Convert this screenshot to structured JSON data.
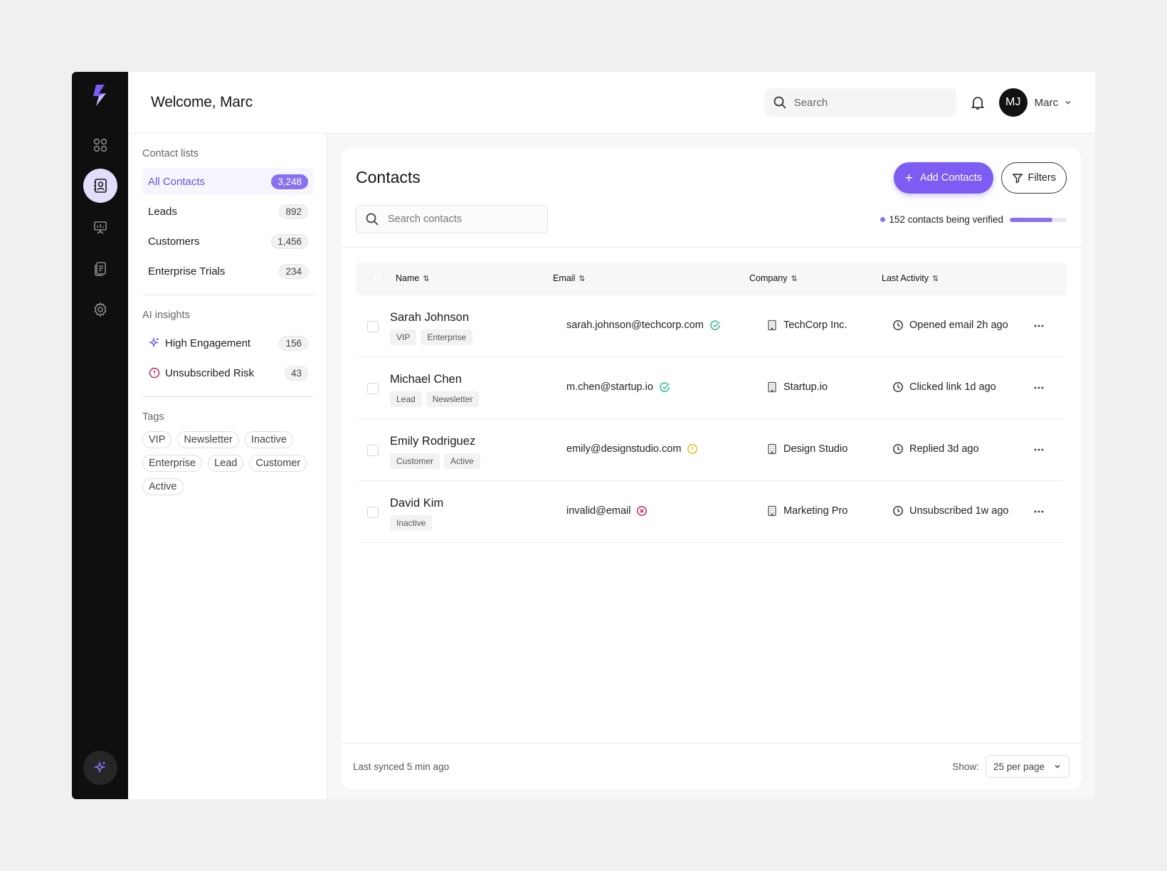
{
  "header": {
    "welcome": "Welcome, Marc",
    "search_placeholder": "Search",
    "avatar_initials": "MJ",
    "user_name": "Marc"
  },
  "lists": {
    "contact_lists_title": "Contact lists",
    "items": [
      {
        "label": "All Contacts",
        "count": "3,248",
        "active": true
      },
      {
        "label": "Leads",
        "count": "892"
      },
      {
        "label": "Customers",
        "count": "1,456"
      },
      {
        "label": "Enterprise Trials",
        "count": "234"
      }
    ],
    "ai_title": "AI insights",
    "ai_items": [
      {
        "label": "High Engagement",
        "count": "156",
        "icon": "sparkle-icon"
      },
      {
        "label": "Unsubscribed Risk",
        "count": "43",
        "icon": "alert-circle-icon"
      }
    ],
    "tags_title": "Tags",
    "tags": [
      "VIP",
      "Newsletter",
      "Inactive",
      "Enterprise",
      "Lead",
      "Customer",
      "Active"
    ]
  },
  "contacts": {
    "title": "Contacts",
    "add_label": "Add Contacts",
    "filters_label": "Filters",
    "search_placeholder": "Search contacts",
    "verifying_text": "152 contacts being verified",
    "verify_progress": 0.75,
    "columns": {
      "name": "Name",
      "email": "Email",
      "company": "Company",
      "activity": "Last Activity"
    },
    "rows": [
      {
        "name": "Sarah Johnson",
        "tags": [
          "VIP",
          "Enterprise"
        ],
        "email": "sarah.johnson@techcorp.com",
        "email_status": "verified",
        "company": "TechCorp Inc.",
        "activity": "Opened email 2h ago"
      },
      {
        "name": "Michael Chen",
        "tags": [
          "Lead",
          "Newsletter"
        ],
        "email": "m.chen@startup.io",
        "email_status": "verified",
        "company": "Startup.io",
        "activity": "Clicked link 1d ago"
      },
      {
        "name": "Emily Rodriguez",
        "tags": [
          "Customer",
          "Active"
        ],
        "email": "emily@designstudio.com",
        "email_status": "warning",
        "company": "Design Studio",
        "activity": "Replied 3d ago"
      },
      {
        "name": "David Kim",
        "tags": [
          "Inactive"
        ],
        "email": "invalid@email",
        "email_status": "invalid",
        "company": "Marketing Pro",
        "activity": "Unsubscribed 1w ago"
      }
    ],
    "footer": {
      "synced": "Last synced 5 min ago",
      "show_label": "Show:",
      "per_page": "25 per page"
    }
  },
  "colors": {
    "accent": "#7c5cf2",
    "verified": "#2fb38a",
    "warning": "#e9b616",
    "invalid": "#c6245a"
  }
}
